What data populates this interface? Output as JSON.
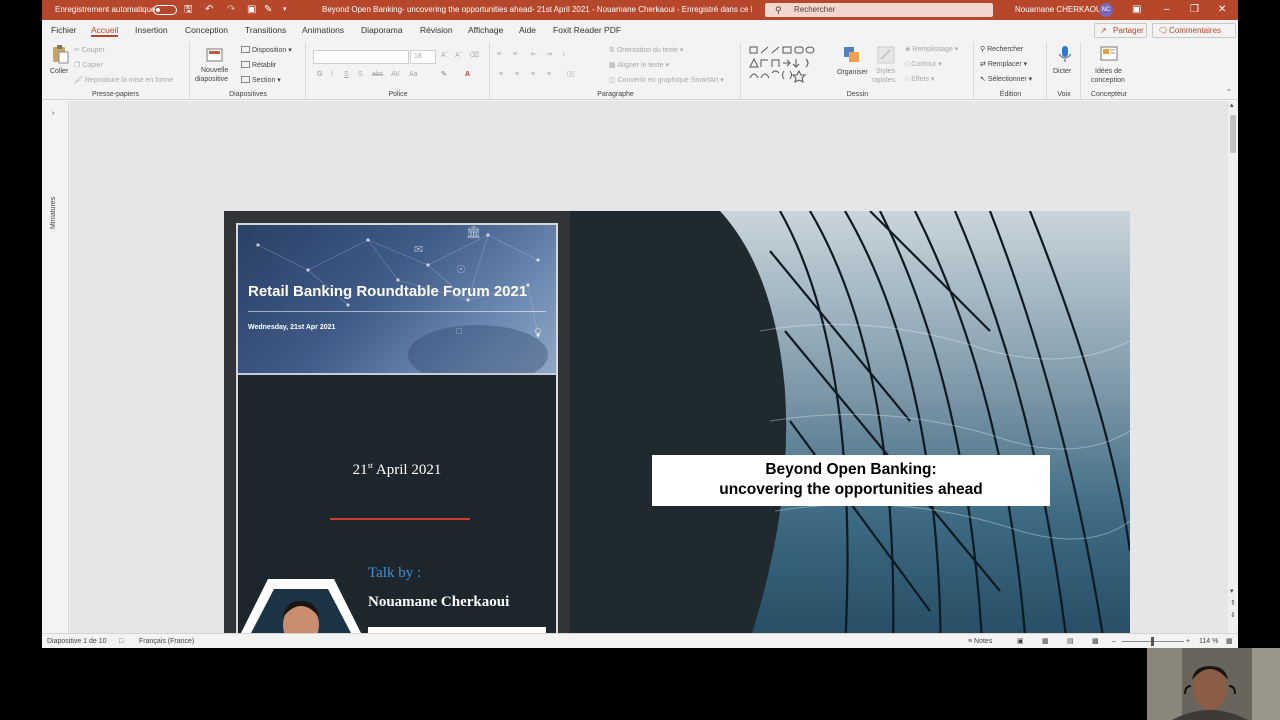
{
  "titlebar": {
    "autosave_label": "Enregistrement automatique",
    "doc_title": "Beyond Open Banking- uncovering the opportunities ahead- 21st April 2021 - Nouamane Cherkaoui  -  Enregistré dans ce PC",
    "search_placeholder": "Rechercher",
    "user_name": "Nouamane CHERKAOUI",
    "user_initials": "NC"
  },
  "tabs": [
    "Fichier",
    "Accueil",
    "Insertion",
    "Conception",
    "Transitions",
    "Animations",
    "Diaporama",
    "Révision",
    "Affichage",
    "Aide",
    "Foxit Reader PDF"
  ],
  "active_tab": "Accueil",
  "share_label": "Partager",
  "comments_label": "Commentaires",
  "ribbon": {
    "clipboard": {
      "label": "Presse-papiers",
      "paste": "Coller",
      "cut": "Couper",
      "copy": "Copier",
      "format_painter": "Reproduire la mise en forme"
    },
    "slides": {
      "label": "Diapositives",
      "new_slide": "Nouvelle",
      "new_slide_2": "diapositive",
      "layout": "Disposition",
      "reset": "Rétablir",
      "section": "Section"
    },
    "font": {
      "label": "Police",
      "size": "18"
    },
    "paragraph": {
      "label": "Paragraphe",
      "text_direction": "Orientation du texte",
      "align_text": "Aligner le texte",
      "smartart": "Convertir en graphique SmartArt"
    },
    "drawing": {
      "label": "Dessin",
      "arrange": "Organiser",
      "quick_styles": "Styles",
      "quick_styles_2": "rapides",
      "fill": "Remplissage",
      "outline": "Contour",
      "effects": "Effets"
    },
    "editing": {
      "label": "Édition",
      "find": "Rechercher",
      "replace": "Remplacer",
      "select": "Sélectionner"
    },
    "voice": {
      "label": "Voix",
      "dictate": "Dicter"
    },
    "designer": {
      "label": "Concepteur",
      "ideas": "Idées de",
      "ideas_2": "conception"
    }
  },
  "thumbnails_label": "Miniatures",
  "slide": {
    "banner_title": "Retail Banking Roundtable Forum 2021",
    "banner_date": "Wednesday, 21st Apr 2021",
    "date_day": "21",
    "date_suffix": "st",
    "date_rest": " April 2021",
    "talk_by": "Talk by  :",
    "speaker": "Nouamane Cherkaoui",
    "title_line1": "Beyond Open Banking:",
    "title_line2": "uncovering the opportunities ahead",
    "social_icons": [
      "skype-icon",
      "twitter-icon",
      "linkedin-icon",
      "google-plus-icon",
      "youtube-icon"
    ]
  },
  "statusbar": {
    "slide_info": "Diapositive 1 de 10",
    "language": "Français (France)",
    "notes": "Notes",
    "zoom": "114 %"
  }
}
